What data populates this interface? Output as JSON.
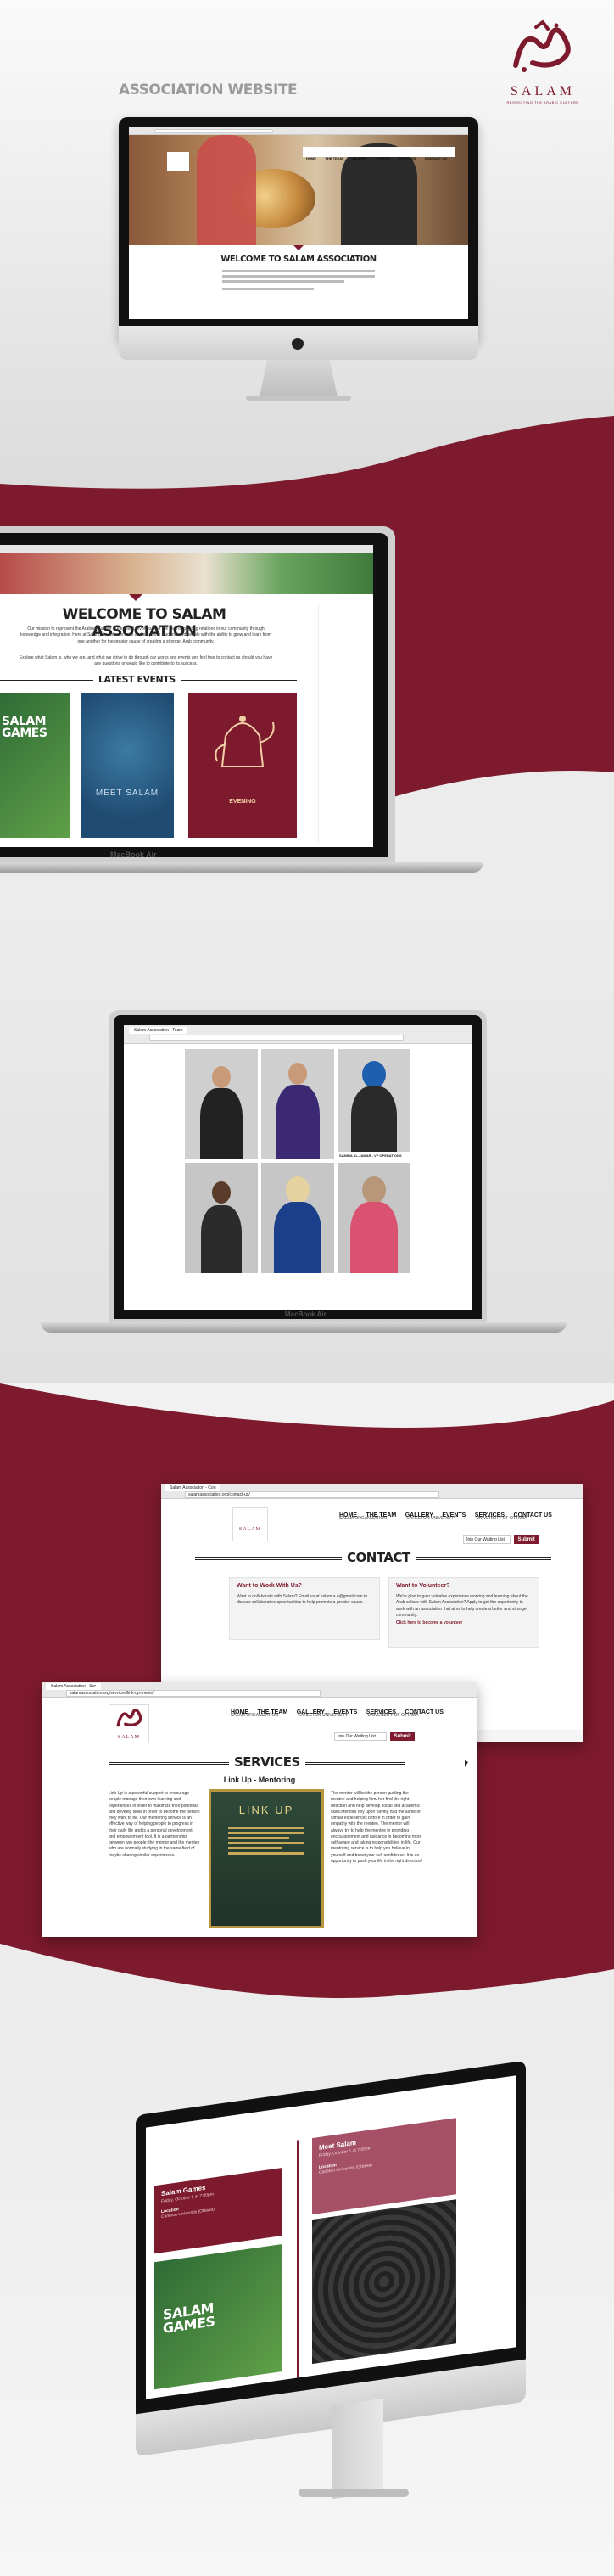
{
  "brand": {
    "name": "SALAM",
    "tagline": "RESPECTING THE ARABIC CULTURE",
    "color": "#7d1a2d"
  },
  "section1": {
    "title": "ASSOCIATION WEBSITE",
    "site_nav": [
      "HOME",
      "THE TEAM",
      "GALLERY",
      "EVENTS",
      "SERVICES",
      "CONTACT US"
    ],
    "hero_heading": "WELCOME TO SALAM ASSOCIATION",
    "logo_text": "SALAM"
  },
  "section2": {
    "heading": "WELCOME TO SALAM ASSOCIATION",
    "paragraph1": "Our mission to represent the Arabian Culture is eternal. It revolves over the idea of creating relations in our community through knowledge and integration. Here at Salam, we strive to unite and empower students and people with the ability to grow and learn from one another for the greater cause of creating a stronger Arab community.",
    "paragraph2": "Explore what Salam is, who we are, and what we strive to do through our works and events and feel free to contact us should you have any questions or would like to contribute to its success.",
    "events_heading": "LATEST EVENTS",
    "event_tiles": [
      "SALAM GAMES",
      "MEET SALAM",
      "EVENING"
    ],
    "laptop_label": "MacBook Air"
  },
  "section3": {
    "browser_tab": "Salam Association - Team",
    "caption": "SAMIRA AL-JAMAR - VP OPERATIONS",
    "laptop_label": "MacBook Air"
  },
  "section4": {
    "contact_page": {
      "tab": "Salam Association - Con",
      "url": "salamassociation.org/contact-us/",
      "nav": [
        "HOME",
        "THE TEAM",
        "GALLERY",
        "EVENTS",
        "SERVICES",
        "CONTACT US"
      ],
      "sub_nav": [
        "SALAM ORGANIZATION",
        "CARLETON UNIVERSITY",
        "UNIVERSITY OF OTTAWA"
      ],
      "waiting_list": "Join Our Waiting List",
      "submit": "Submit",
      "heading": "CONTACT",
      "card1_title": "Want to Work With Us?",
      "card1_text": "Want to collaborate with Salam? Email us at salam.a.o@gmail.com to discuss collaborative opportunities to help promote a greater cause.",
      "card2_title": "Want to Volunteer?",
      "card2_text": "We're glad to gain valuable experience working and learning about the Arab culture with Salam Association? Apply to get the opportunity to work with an association that aims to help create a better and stronger community.",
      "card2_link": "Click here to become a volunteer"
    },
    "services_page": {
      "tab": "Salam Association - Ser",
      "url": "salamassociation.org/services/link-up-mento/",
      "nav": [
        "HOME",
        "THE TEAM",
        "GALLERY",
        "EVENTS",
        "SERVICES",
        "CONTACT US"
      ],
      "sub_nav": [
        "SALAM ORGANIZATION",
        "CARLETON UNIVERSITY",
        "UNIVERSITY OF OTTAWA"
      ],
      "waiting_list": "Join Our Waiting List",
      "submit": "Submit",
      "heading": "SERVICES",
      "subheading": "Link Up - Mentoring",
      "poster_title": "LINK UP",
      "col1": "Link Up is a powerful support to encourage people manage their own learning and experiences in order to maximize their potential and develop skills in order to become the person they want to be. Our mentoring service is an effective way of helping people to progress in their daily life and is a personal development and empowerment tool. It is a partnership between two people; the mentor and the mentee who are normally studying in the same field of maybe sharing similar experiences.",
      "col3": "The mentor will be the person guiding the mentee and helping him/ her find the right direction and help develop social and academic skills.Mentors rely upon having had the same or similar experiences before in order to gain empathy with the mentee. The mentor will always try to help the mentee in providing encouragement and guidance in becoming more self aware and taking responsibilities in life. Our mentoring service is to help you believe in yourself and boost your self confidence. It is an opportunity to push your life in the right direction!"
    }
  },
  "section5": {
    "event1_title": "Salam Games",
    "event1_date": "Friday, October 1 at 7:00pm",
    "event2_title": "Meet Salam",
    "event2_date": "Friday, October 1 at 7:00pm",
    "location_label": "Location",
    "location": "Carleton University (Ottawa)",
    "tile_text": "SALAM GAMES"
  }
}
